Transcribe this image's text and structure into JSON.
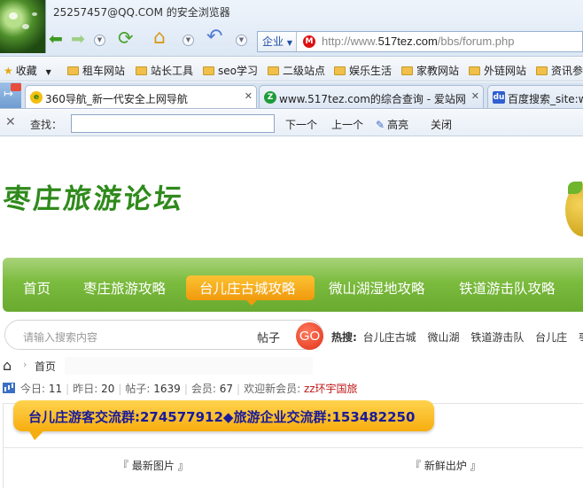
{
  "window": {
    "title": "25257457@QQ.COM 的安全浏览器"
  },
  "address": {
    "tag": "企业",
    "url_prefix": "http://www.",
    "url_domain": "517tez.com",
    "url_path": "/bbs/forum.php"
  },
  "favorites": {
    "label": "收藏",
    "items": [
      "租车网站",
      "站长工具",
      "seo学习",
      "二级站点",
      "娱乐生活",
      "家教网站",
      "外链网站",
      "资讯参"
    ]
  },
  "tabs": [
    {
      "label": "360导航_新一代安全上网导航",
      "active": true
    },
    {
      "label": "www.517tez.com的综合查询 - 爱站网",
      "active": false
    },
    {
      "label": "百度搜索_site:w",
      "active": false
    }
  ],
  "findbar": {
    "label": "查找：",
    "next": "下一个",
    "prev": "上一个",
    "highlight": "高亮",
    "close": "关闭"
  },
  "site": {
    "logo": "枣庄旅游论坛",
    "nav": [
      {
        "label": "首页",
        "active": false
      },
      {
        "label": "枣庄旅游攻略",
        "active": false
      },
      {
        "label": "台儿庄古城攻略",
        "active": true
      },
      {
        "label": "微山湖湿地攻略",
        "active": false
      },
      {
        "label": "铁道游击队攻略",
        "active": false
      }
    ],
    "search": {
      "placeholder": "请输入搜索内容",
      "type": "帖子",
      "go": "GO"
    },
    "hot": {
      "label": "热搜:",
      "items": [
        "台儿庄古城",
        "微山湖",
        "铁道游击队",
        "台儿庄",
        "枣"
      ]
    },
    "breadcrumb": {
      "home": "首页"
    },
    "stats": {
      "today_label": "今日:",
      "today": "11",
      "yesterday_label": "昨日:",
      "yesterday": "20",
      "posts_label": "帖子:",
      "posts": "1639",
      "members_label": "会员:",
      "members": "67",
      "welcome_label": "欢迎新会员:",
      "new_member": "zz环宇国旅"
    },
    "banner": "台儿庄游客交流群:274577912◆旅游企业交流群:153482250",
    "sections": [
      "『 最新图片 』",
      "『 新鲜出炉 』"
    ]
  }
}
